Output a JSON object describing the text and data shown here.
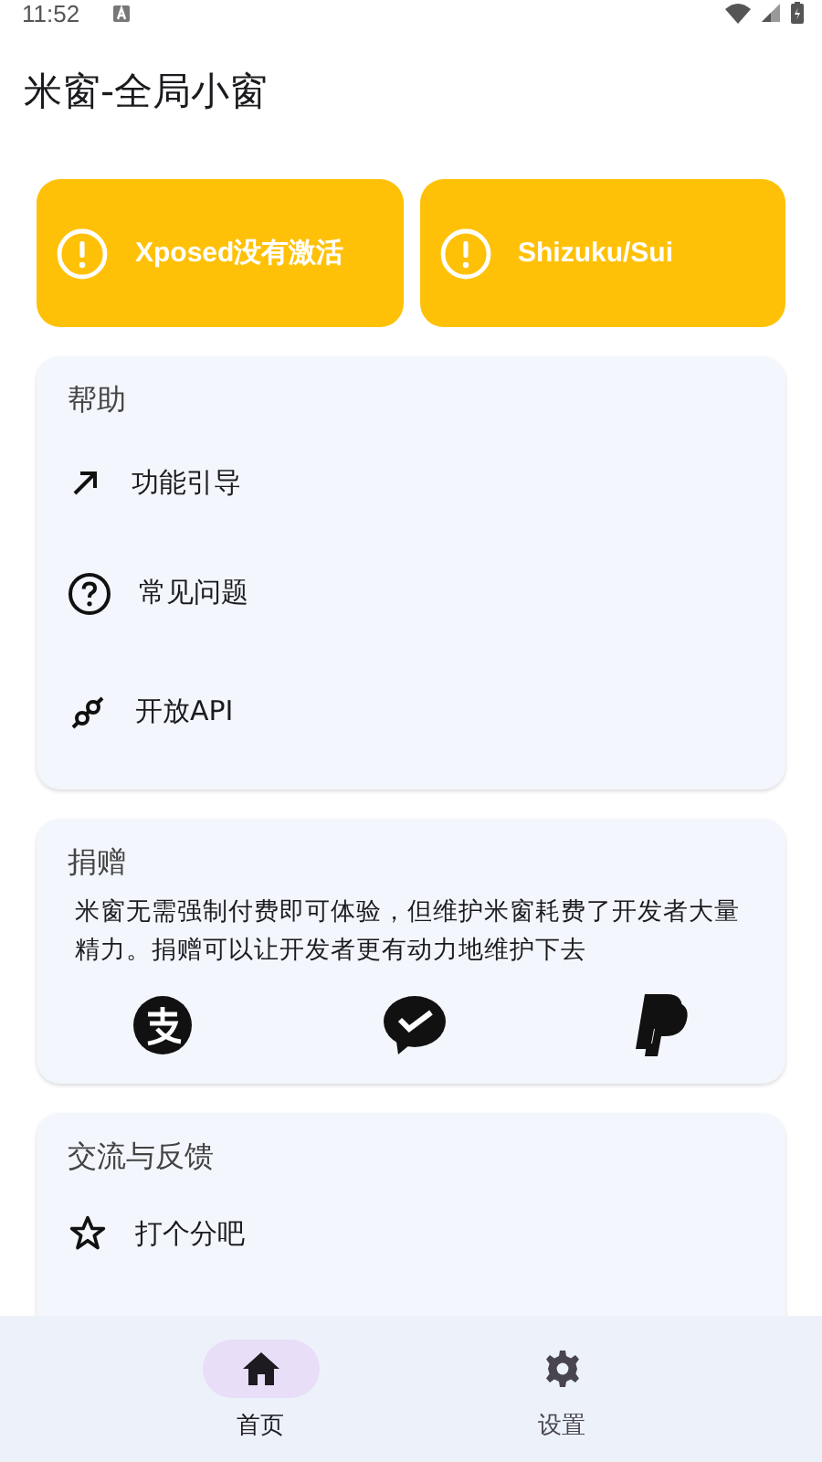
{
  "status_bar": {
    "time": "11:52"
  },
  "app_bar": {
    "title": "米窗-全局小窗"
  },
  "warnings": [
    {
      "label": "Xposed没有激活"
    },
    {
      "label": "Shizuku/Sui"
    }
  ],
  "help": {
    "title": "帮助",
    "items": [
      {
        "kind": "guide",
        "label": "功能引导"
      },
      {
        "kind": "faq",
        "label": "常见问题"
      },
      {
        "kind": "api",
        "label": "开放API"
      }
    ]
  },
  "donate": {
    "title": "捐赠",
    "text": "米窗无需强制付费即可体验，但维护米窗耗费了开发者大量精力。捐赠可以让开发者更有动力地维护下去",
    "methods": [
      {
        "kind": "alipay"
      },
      {
        "kind": "wechat"
      },
      {
        "kind": "paypal"
      }
    ]
  },
  "feedback": {
    "title": "交流与反馈",
    "items": [
      {
        "kind": "rate",
        "label": "打个分吧"
      }
    ]
  },
  "nav": [
    {
      "kind": "home",
      "label": "首页",
      "selected": true
    },
    {
      "kind": "settings",
      "label": "设置",
      "selected": false
    }
  ]
}
